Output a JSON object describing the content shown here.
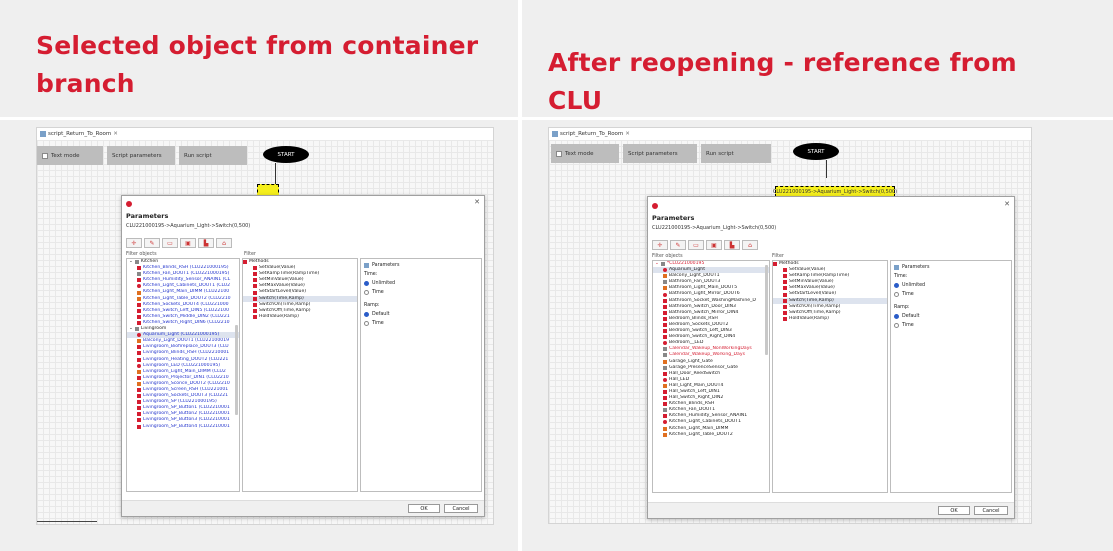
{
  "left": {
    "heading_line1": "Selected object from container",
    "heading_line2": "branch",
    "tab_label": "script_Return_To_Room",
    "toolbar": {
      "text_mode": "Text mode",
      "script_params": "Script parameters",
      "run_script": "Run script"
    },
    "start_label": "START",
    "dialog": {
      "title": "Parameters",
      "subtitle": "CLU221000195->Aquarium_Light->Switch(0,500)",
      "filter_objects": "Filter objects",
      "filter": "Filter",
      "tree": [
        {
          "text": "Kitchen",
          "cls": "dark",
          "icon": "g",
          "indent": 0
        },
        {
          "text": "Kitchen_Blinds_RSH (CLU221000195)",
          "cls": "blue",
          "icon": "r",
          "indent": 1
        },
        {
          "text": "Kitchen_Fan_DOUT1 (CLU221000195)",
          "cls": "blue",
          "icon": "g",
          "indent": 1
        },
        {
          "text": "Kitchen_Humidity_Sensor_ANAIN1 (CL",
          "cls": "blue",
          "icon": "r",
          "indent": 1
        },
        {
          "text": "Kitchen_Light_Cabinets_DOUT1 (CLU2",
          "cls": "blue",
          "icon": "c",
          "indent": 1
        },
        {
          "text": "Kitchen_Light_Main_DIMM (CLU22100",
          "cls": "blue",
          "icon": "o",
          "indent": 1
        },
        {
          "text": "Kitchen_Light_Table_DOUT2 (CLU2210",
          "cls": "blue",
          "icon": "o",
          "indent": 1
        },
        {
          "text": "Kitchen_Sockets_DOUT4 (CLU221000",
          "cls": "blue",
          "icon": "r",
          "indent": 1
        },
        {
          "text": "Kitchen_Switch_Left_DIN5 (CLU22100",
          "cls": "blue",
          "icon": "r",
          "indent": 1
        },
        {
          "text": "Kitchen_Switch_Middle_DIN2 (CLU221",
          "cls": "blue",
          "icon": "r",
          "indent": 1
        },
        {
          "text": "Kitchen_Switch_Right_DIN6 (CLU2210",
          "cls": "blue",
          "icon": "r",
          "indent": 1
        },
        {
          "text": "Livingroom",
          "cls": "dark",
          "icon": "g",
          "indent": 0
        },
        {
          "text": "Aquarium_Light (CLU221000195)",
          "cls": "blue sel",
          "icon": "c",
          "indent": 1
        },
        {
          "text": "Balcony_Light_DOUT1 (CLU22100019",
          "cls": "blue",
          "icon": "o",
          "indent": 1
        },
        {
          "text": "Livingroom_Biofireplace_DOUT3 (CLU",
          "cls": "blue",
          "icon": "r",
          "indent": 1
        },
        {
          "text": "Livingroom_Blinds_RSH (CLU2210001",
          "cls": "blue",
          "icon": "r",
          "indent": 1
        },
        {
          "text": "Livingroom_Heating_DOUT2 (CLU221",
          "cls": "blue",
          "icon": "r",
          "indent": 1
        },
        {
          "text": "Livingroom_LED (CLU221000195)",
          "cls": "blue",
          "icon": "c",
          "indent": 1
        },
        {
          "text": "Livingroom_Light_Main_DIMM (CLU2",
          "cls": "blue",
          "icon": "o",
          "indent": 1
        },
        {
          "text": "Livingroom_Projector_DIN1 (CLU2210",
          "cls": "blue",
          "icon": "r",
          "indent": 1
        },
        {
          "text": "Livingroom_Sconce_DOUT2 (CLU2210",
          "cls": "blue",
          "icon": "o",
          "indent": 1
        },
        {
          "text": "Livingroom_Screen_RSH (CLU221001",
          "cls": "blue",
          "icon": "r",
          "indent": 1
        },
        {
          "text": "Livingroom_Sockets_DOUT3 (CLU221",
          "cls": "blue",
          "icon": "r",
          "indent": 1
        },
        {
          "text": "Livingroom_SP (CLU221000195)",
          "cls": "blue",
          "icon": "r",
          "indent": 1
        },
        {
          "text": "Livingroom_SP_Button1 (CLU2210001",
          "cls": "blue",
          "icon": "r",
          "indent": 1
        },
        {
          "text": "Livingroom_SP_Button2 (CLU2210001",
          "cls": "blue",
          "icon": "r",
          "indent": 1
        },
        {
          "text": "Livingroom_SP_Button3 (CLU2210001",
          "cls": "blue",
          "icon": "r",
          "indent": 1
        },
        {
          "text": "Livingroom_SP_Button4 (CLU2210001",
          "cls": "blue",
          "icon": "r",
          "indent": 1
        }
      ],
      "methods_header": "Methods",
      "methods": [
        "SetValue(Value)",
        "SetRampTime(RampTime)",
        "SetMinValue(Value)",
        "SetMaxValue(Value)",
        "SetStartLevel(Value)",
        "Switch(Time,Ramp)",
        "SwitchOn(Time,Ramp)",
        "SwitchOff(Time,Ramp)",
        "HoldValue(Ramp)"
      ],
      "params": {
        "header": "Parameters",
        "time": "Time:",
        "unlimited": "Unlimited",
        "time_opt": "Time",
        "ramp": "Ramp:",
        "default": "Default",
        "time_opt2": "Time"
      },
      "ok": "OK",
      "cancel": "Cancel"
    }
  },
  "right": {
    "heading": "After reopening - reference from CLU",
    "tab_label": "script_Return_To_Room",
    "toolbar": {
      "text_mode": "Text mode",
      "script_params": "Script parameters",
      "run_script": "Run script"
    },
    "start_label": "START",
    "node_label": "CLU221000195->Aquarium_Light->Switch(0,500)",
    "dialog": {
      "title": "Parameters",
      "subtitle": "CLU221000195->Aquarium_Light->Switch(0,500)",
      "filter_objects": "Filter objects",
      "filter": "Filter",
      "tree": [
        {
          "text": "*CLU221000195",
          "cls": "red",
          "icon": "g",
          "indent": 0
        },
        {
          "text": "Aquarium_Light",
          "cls": "dark sel",
          "icon": "c",
          "indent": 1
        },
        {
          "text": "Balcony_Light_DOUT1",
          "cls": "dark",
          "icon": "o",
          "indent": 1
        },
        {
          "text": "Bathroom_Fan_DOUT3",
          "cls": "dark",
          "icon": "g",
          "indent": 1
        },
        {
          "text": "Bathroom_Light_Main_DOUT5",
          "cls": "dark",
          "icon": "o",
          "indent": 1
        },
        {
          "text": "Bathroom_Light_Mirror_DOUT6",
          "cls": "dark",
          "icon": "c",
          "indent": 1
        },
        {
          "text": "Bathroom_Socket_WashingMashine_D",
          "cls": "dark",
          "icon": "r",
          "indent": 1
        },
        {
          "text": "Bathroom_Switch_Door_DIN3",
          "cls": "dark",
          "icon": "r",
          "indent": 1
        },
        {
          "text": "Bathroom_Switch_Mirror_DIN4",
          "cls": "dark",
          "icon": "r",
          "indent": 1
        },
        {
          "text": "Bedroom_Blinds_RSH",
          "cls": "dark",
          "icon": "r",
          "indent": 1
        },
        {
          "text": "Bedroom_Sockets_DOUT2",
          "cls": "dark",
          "icon": "r",
          "indent": 1
        },
        {
          "text": "Bedroom_Switch_Left_DIN3",
          "cls": "dark",
          "icon": "r",
          "indent": 1
        },
        {
          "text": "Bedroom_Switch_Right_DIN4",
          "cls": "dark",
          "icon": "r",
          "indent": 1
        },
        {
          "text": "Bedroom__LED",
          "cls": "dark",
          "icon": "c",
          "indent": 1
        },
        {
          "text": "Calendar_Wakeup_NonWorkingDays",
          "cls": "red",
          "icon": "g",
          "indent": 1
        },
        {
          "text": "Calendar_Wakeup_Working_Days",
          "cls": "red",
          "icon": "g",
          "indent": 1
        },
        {
          "text": "Garage_Light_Gate",
          "cls": "dark",
          "icon": "o",
          "indent": 1
        },
        {
          "text": "Garage_PresenceSensor_Gate",
          "cls": "dark",
          "icon": "g",
          "indent": 1
        },
        {
          "text": "Hall_Door_ReedSwitch",
          "cls": "dark",
          "icon": "r",
          "indent": 1
        },
        {
          "text": "Hall_LED",
          "cls": "dark",
          "icon": "c",
          "indent": 1
        },
        {
          "text": "Hall_Light_Main_DOUT4",
          "cls": "dark",
          "icon": "o",
          "indent": 1
        },
        {
          "text": "Hall_Switch_Left_DIN1",
          "cls": "dark",
          "icon": "r",
          "indent": 1
        },
        {
          "text": "Hall_Switch_Right_DIN2",
          "cls": "dark",
          "icon": "r",
          "indent": 1
        },
        {
          "text": "Kitchen_Blinds_RSH",
          "cls": "dark",
          "icon": "r",
          "indent": 1
        },
        {
          "text": "Kitchen_Fan_DOUT1",
          "cls": "dark",
          "icon": "g",
          "indent": 1
        },
        {
          "text": "Kitchen_Humidity_Sensor_ANAIN1",
          "cls": "dark",
          "icon": "r",
          "indent": 1
        },
        {
          "text": "Kitchen_Light_Cabinets_DOUT1",
          "cls": "dark",
          "icon": "c",
          "indent": 1
        },
        {
          "text": "Kitchen_Light_Main_DIMM",
          "cls": "dark",
          "icon": "o",
          "indent": 1
        },
        {
          "text": "Kitchen_Light_Table_DOUT2",
          "cls": "dark",
          "icon": "o",
          "indent": 1
        }
      ],
      "methods_header": "Methods",
      "methods": [
        "SetValue(Value)",
        "SetRampTime(RampTime)",
        "SetMinValue(Value)",
        "SetMaxValue(Value)",
        "SetStartLevel(Value)",
        "Switch(Time,Ramp)",
        "SwitchOn(Time,Ramp)",
        "SwitchOff(Time,Ramp)",
        "HoldValue(Ramp)"
      ],
      "params": {
        "header": "Parameters",
        "time": "Time:",
        "unlimited": "Unlimited",
        "time_opt": "Time",
        "ramp": "Ramp:",
        "default": "Default",
        "time_opt2": "Time"
      },
      "ok": "OK",
      "cancel": "Cancel"
    }
  },
  "colors": {
    "heading": "#d51d31",
    "toolbar_button": "#bdbdbd",
    "node_yellow": "#f5ef1c",
    "selected_row": "#dde3ee",
    "radio_on": "#2a5cc8"
  },
  "icons": [
    "script-tab-icon",
    "checkbox-icon",
    "alert-icon",
    "close-icon",
    "toolbar-tool-icons",
    "tree-item-icons",
    "radio-icons"
  ]
}
